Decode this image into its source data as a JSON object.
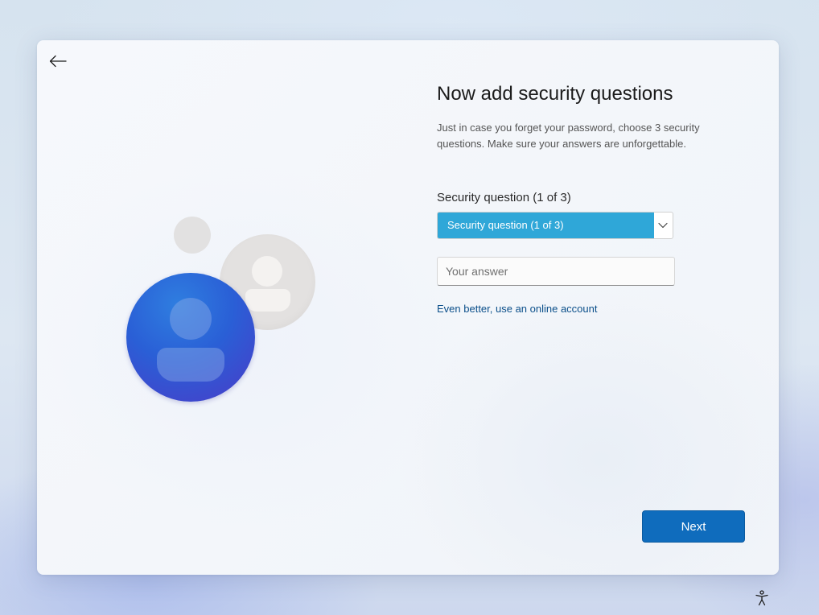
{
  "page": {
    "title": "Now add security questions",
    "description": "Just in case you forget your password, choose 3 security questions. Make sure your answers are unforgettable."
  },
  "security_question": {
    "label": "Security question (1 of 3)",
    "selected_value": "Security question (1 of 3)",
    "highlight_color": "#2fa7d8"
  },
  "answer": {
    "placeholder": "Your answer",
    "value": ""
  },
  "online_account_link": "Even better, use an online account",
  "next_button": {
    "label": "Next",
    "color": "#0f6cbd"
  },
  "icons": {
    "back": "back-arrow-icon",
    "dropdown": "chevron-down-icon",
    "accessibility": "accessibility-icon",
    "illustration": "user-avatars-illustration"
  }
}
